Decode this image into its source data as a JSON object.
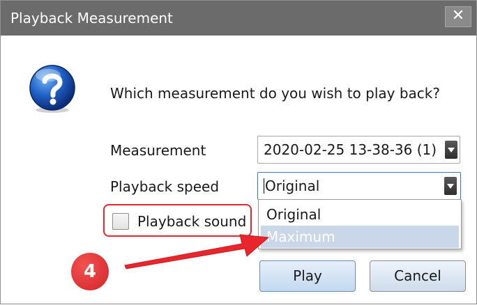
{
  "window": {
    "title": "Playback Measurement",
    "close_glyph": "✕"
  },
  "dialog": {
    "icon": "question-icon",
    "prompt": "Which measurement do you wish to play back?"
  },
  "form": {
    "measurement_label": "Measurement",
    "measurement_value": "2020-02-25 13-38-36 (1)",
    "speed_label": "Playback speed",
    "speed_value": "Original",
    "speed_options": [
      "Original",
      "Maximum"
    ],
    "speed_highlighted_option": "Maximum",
    "sound_label": "Playback sound",
    "sound_checked": false
  },
  "buttons": {
    "play": "Play",
    "cancel": "Cancel"
  },
  "annotation": {
    "step_number": "4",
    "color": "#e8262c"
  },
  "colors": {
    "titlebar": "#6b6b6b",
    "selection": "#c9d7e8",
    "annotation_red": "#e8262c"
  }
}
